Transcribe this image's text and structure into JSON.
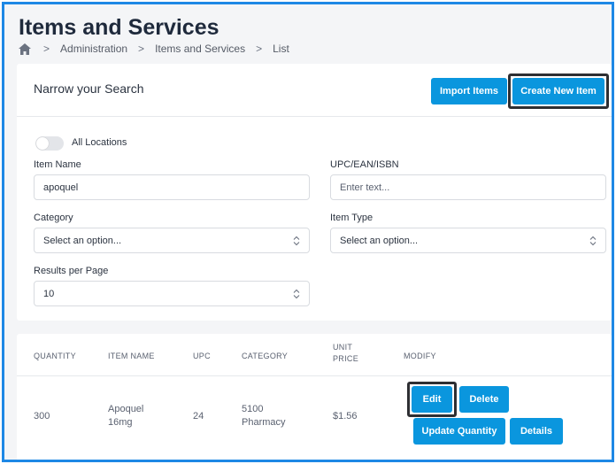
{
  "page": {
    "title": "Items and Services"
  },
  "breadcrumb": {
    "home_icon": "home-icon",
    "items": [
      "Administration",
      "Items and Services",
      "List"
    ],
    "separator": ">"
  },
  "search": {
    "title": "Narrow your Search",
    "import_label": "Import Items",
    "create_label": "Create New Item",
    "all_locations_label": "All Locations",
    "all_locations_on": false,
    "item_name": {
      "label": "Item Name",
      "value": "apoquel"
    },
    "upc": {
      "label": "UPC/EAN/ISBN",
      "placeholder": "Enter text..."
    },
    "category": {
      "label": "Category",
      "value": "Select an option..."
    },
    "item_type": {
      "label": "Item Type",
      "value": "Select an option..."
    },
    "results_per_page": {
      "label": "Results per Page",
      "value": "10"
    }
  },
  "table": {
    "headers": {
      "quantity": "QUANTITY",
      "item_name": "ITEM NAME",
      "upc": "UPC",
      "category": "CATEGORY",
      "unit_price_1": "UNIT",
      "unit_price_2": "PRICE",
      "modify": "MODIFY"
    },
    "rows": [
      {
        "quantity": "300",
        "item_name_1": "Apoquel",
        "item_name_2": "16mg",
        "upc": "24",
        "category_1": "5100",
        "category_2": "Pharmacy",
        "unit_price": "$1.56",
        "actions": {
          "edit": "Edit",
          "delete": "Delete",
          "update_quantity": "Update Quantity",
          "details": "Details"
        }
      }
    ]
  },
  "colors": {
    "accent": "#0a96de",
    "frame": "#1e88e5",
    "highlight_border": "#2e2f33"
  }
}
